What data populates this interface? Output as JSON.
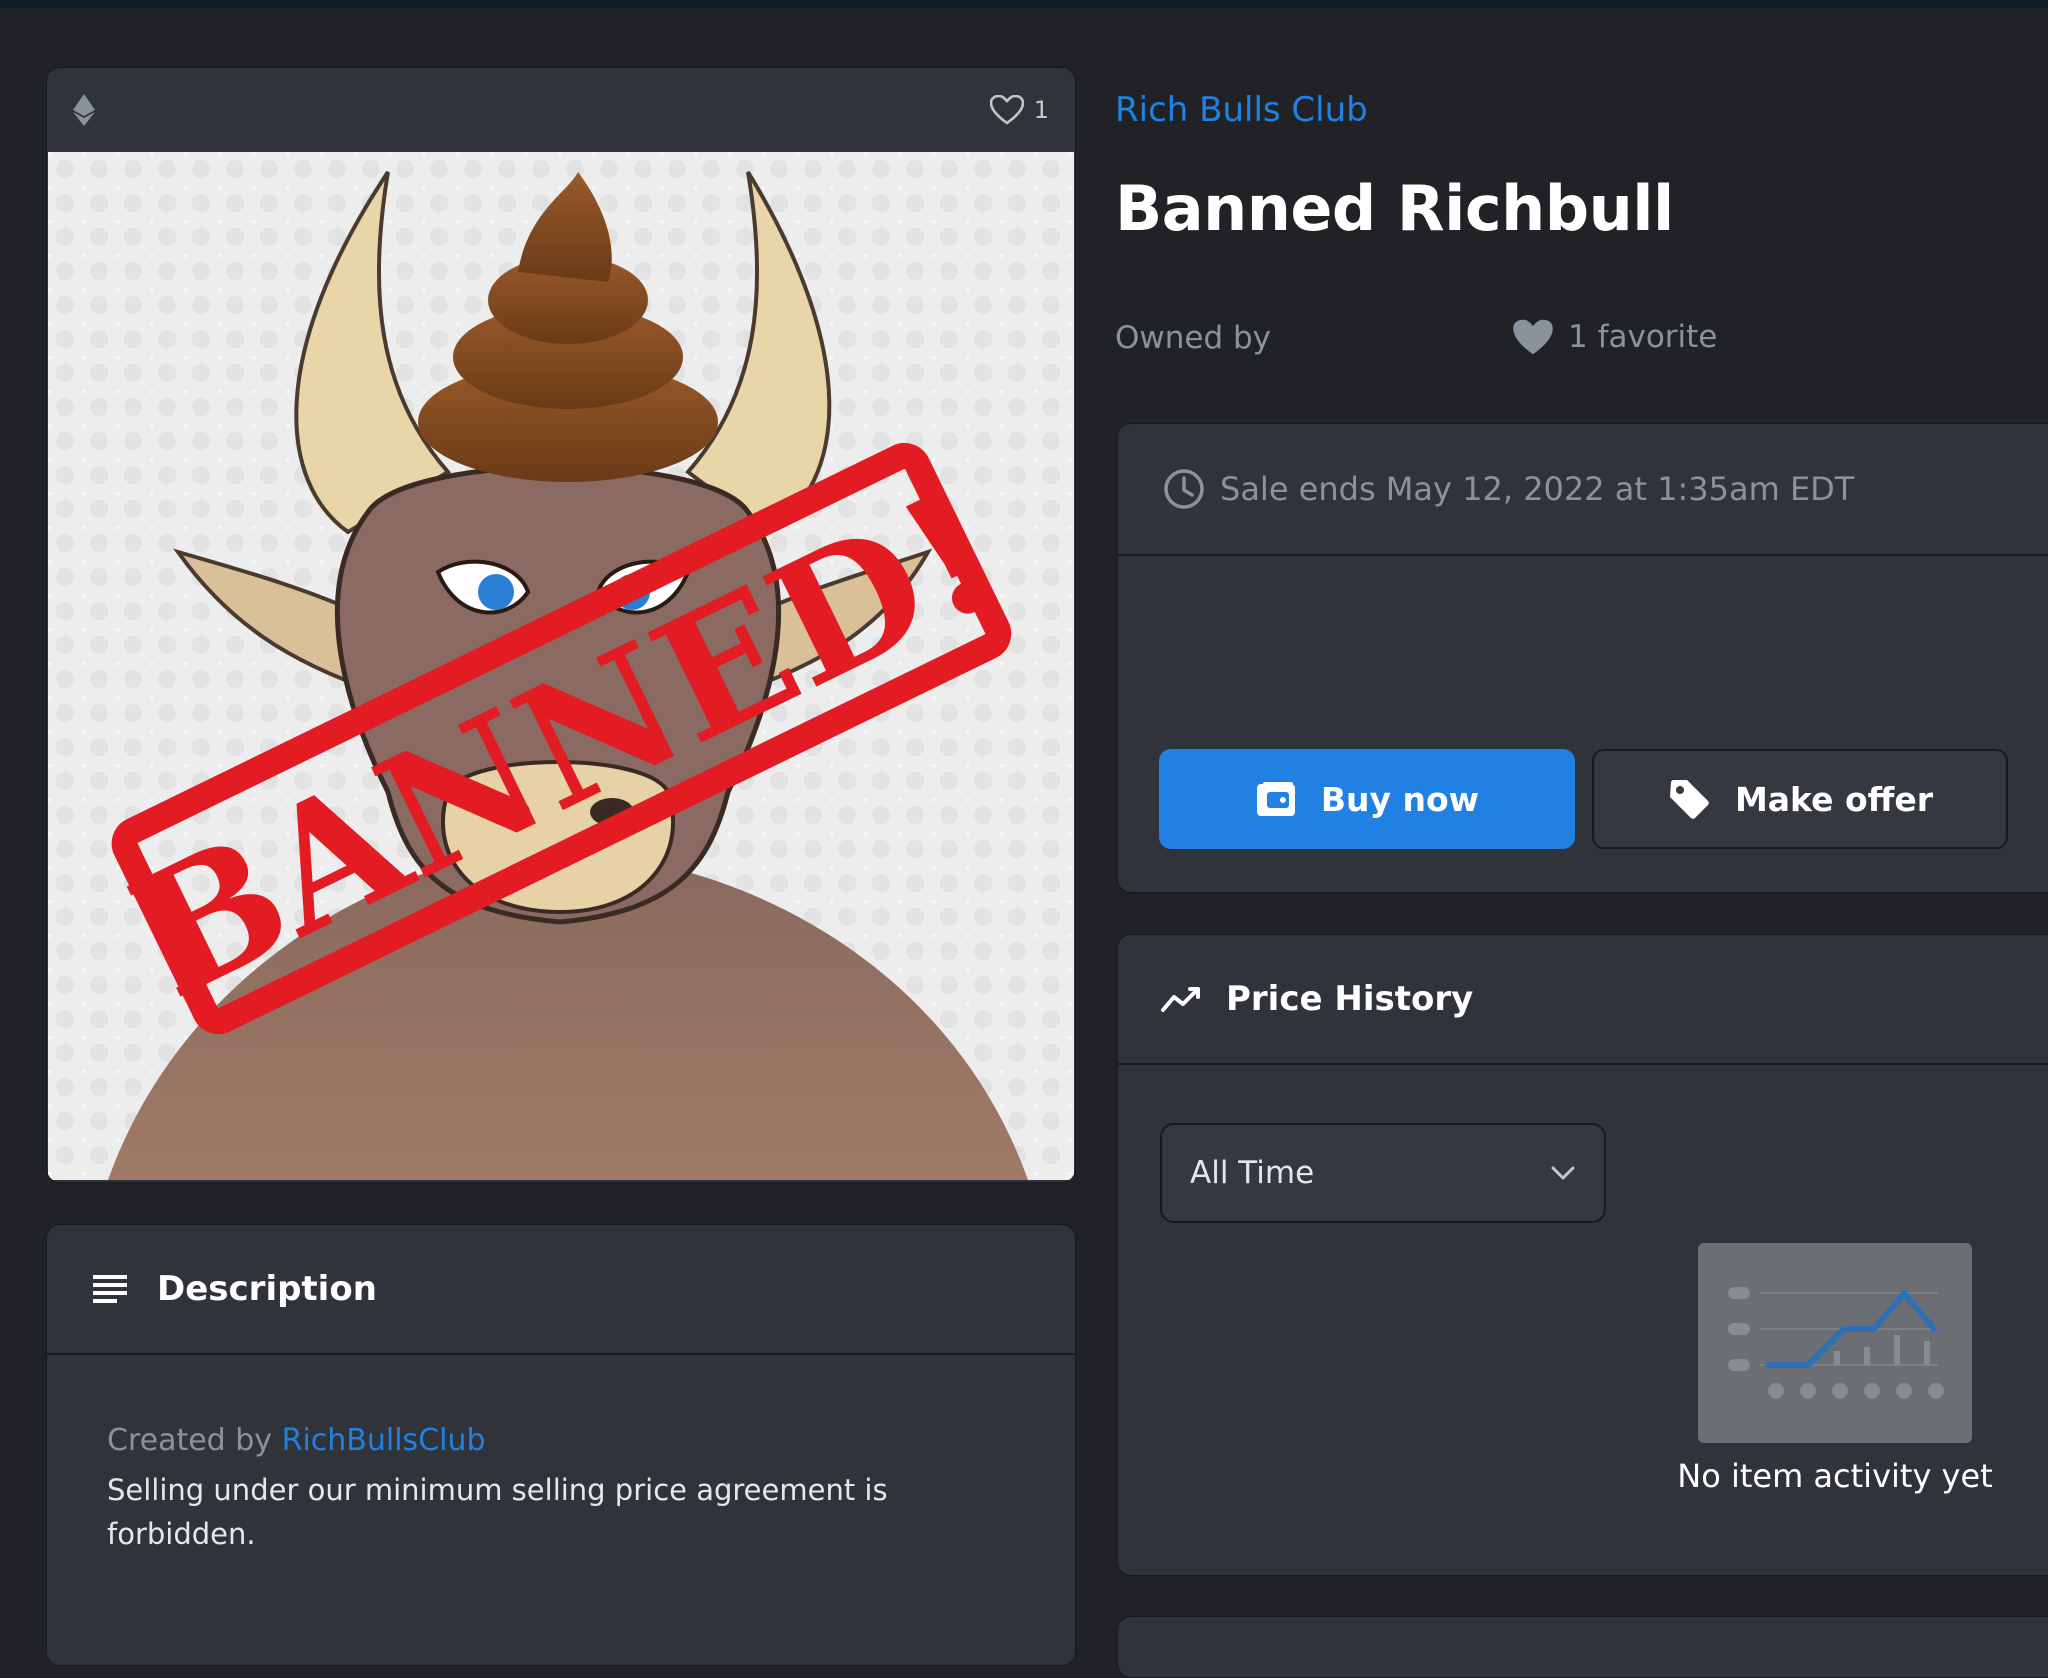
{
  "item": {
    "collection": "Rich Bulls Club",
    "title": "Banned Richbull",
    "owned_by_label": "Owned by",
    "favorites_text": "1 favorite",
    "header_favorite_count": "1"
  },
  "image": {
    "stamp_text": "BANNED!",
    "stamp_color": "#e31b23"
  },
  "sale": {
    "ends_text": "Sale ends May 12, 2022 at 1:35am EDT",
    "buy_label": "Buy now",
    "offer_label": "Make offer"
  },
  "price_history": {
    "title": "Price History",
    "range_selected": "All Time",
    "empty_message": "No item activity yet"
  },
  "description": {
    "title": "Description",
    "created_by_label": "Created by",
    "creator": "RichBullsClub",
    "text": "Selling under our minimum selling price agreement is forbidden."
  },
  "colors": {
    "accent": "#2081e2",
    "background": "#202225",
    "card": "#303339"
  },
  "icons": [
    "ethereum-icon",
    "heart-icon",
    "clock-icon",
    "wallet-icon",
    "tag-icon",
    "trend-icon",
    "chevron-down-icon",
    "description-lines-icon"
  ]
}
